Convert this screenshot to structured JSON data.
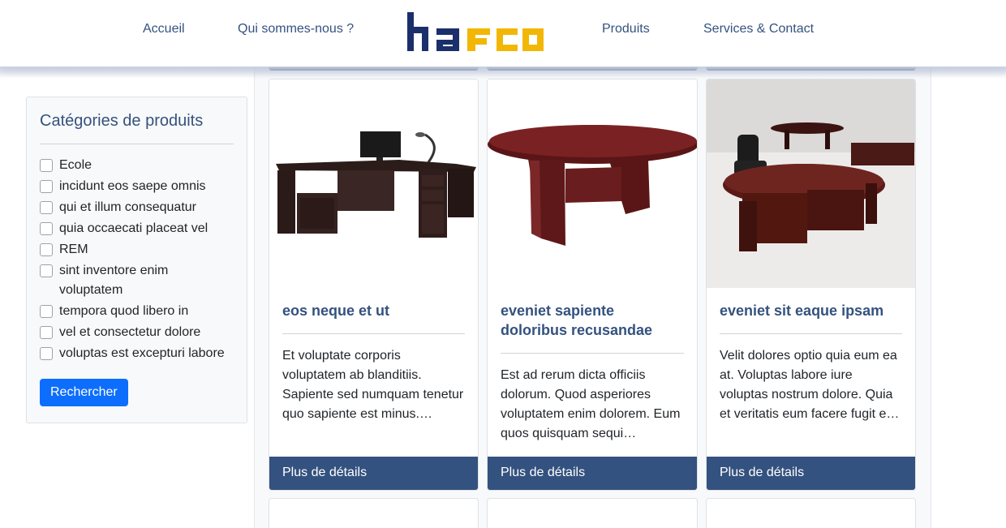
{
  "nav": {
    "home": "Accueil",
    "about": "Qui sommes-nous ?",
    "products": "Produits",
    "contact": "Services & Contact"
  },
  "logo": {
    "text": "hafco",
    "colors": {
      "primary": "#1b2f6b",
      "accent": "#f2b705"
    }
  },
  "sidebar": {
    "title": "Catégories de produits",
    "categories": [
      "Ecole",
      "incidunt eos saepe omnis",
      "qui et illum consequatur",
      "quia occaecati placeat vel",
      "REM",
      "sint inventore enim voluptatem",
      "tempora quod libero in",
      "vel et consectetur dolore",
      "voluptas est excepturi labore"
    ],
    "search_label": "Rechercher"
  },
  "products": [
    {
      "title": "eos neque et ut",
      "description": "Et voluptate corporis voluptatem ab blanditiis. Sapiente sed numquam tenetur quo sapiente est minus.…",
      "button": "Plus de détails"
    },
    {
      "title": "eveniet sapiente doloribus recusandae",
      "description": "Est ad rerum dicta officiis dolorum. Quod asperiores voluptatem enim dolorem. Eum quos quisquam sequi…",
      "button": "Plus de détails"
    },
    {
      "title": "eveniet sit eaque ipsam",
      "description": "Velit dolores optio quia eum ea at. Voluptas labore iure voluptas nostrum dolore. Quia et veritatis eum facere fugit e…",
      "button": "Plus de détails"
    }
  ],
  "colors": {
    "primary_blue": "#34527f",
    "button_blue": "#0d6efd"
  }
}
